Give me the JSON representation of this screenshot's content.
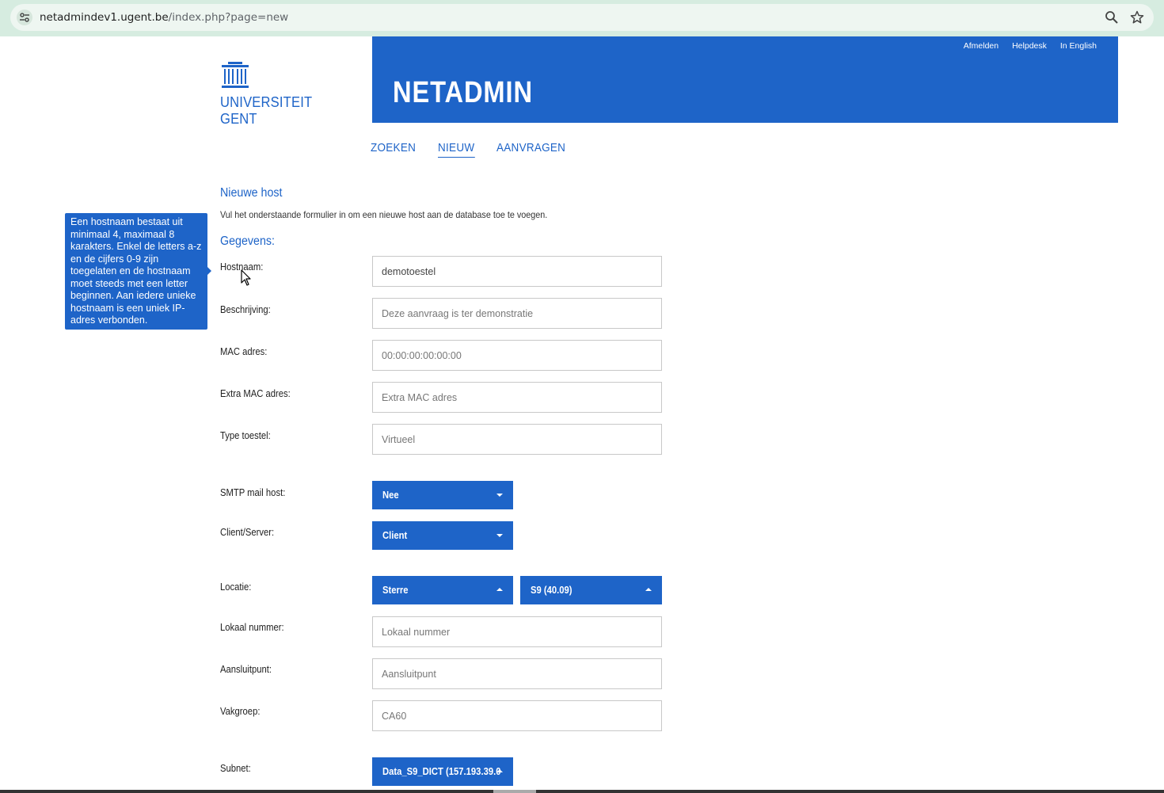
{
  "browser": {
    "url_host": "netadmindev1.ugent.be",
    "url_path": "/index.php?page=new"
  },
  "header": {
    "logo_line1": "UNIVERSITEIT",
    "logo_line2": "GENT",
    "title": "NETADMIN",
    "links": {
      "logout": "Afmelden",
      "helpdesk": "Helpdesk",
      "english": "In English"
    }
  },
  "nav": {
    "search": "ZOEKEN",
    "new": "NIEUW",
    "requests": "AANVRAGEN"
  },
  "page": {
    "title": "Nieuwe host",
    "intro": "Vul het onderstaande formulier in om een nieuwe host aan de database toe te voegen.",
    "section": "Gegevens:"
  },
  "tooltip": {
    "text": "Een hostnaam bestaat uit minimaal 4, maximaal 8 karakters. Enkel de letters a-z en de cijfers 0-9 zijn toegelaten en de hostnaam moet steeds met een letter beginnen. Aan iedere unieke hostnaam is een uniek IP-adres verbonden."
  },
  "form": {
    "hostname": {
      "label": "Hostnaam:",
      "value": "demotoestel",
      "placeholder": ""
    },
    "description": {
      "label": "Beschrijving:",
      "value": "",
      "placeholder": "Deze aanvraag is ter demonstratie"
    },
    "mac": {
      "label": "MAC adres:",
      "value": "",
      "placeholder": "00:00:00:00:00:00"
    },
    "extra_mac": {
      "label": "Extra MAC adres:",
      "value": "",
      "placeholder": "Extra MAC adres"
    },
    "device_type": {
      "label": "Type toestel:",
      "value": "",
      "placeholder": "Virtueel"
    },
    "smtp": {
      "label": "SMTP mail host:",
      "selected": "Nee"
    },
    "client_server": {
      "label": "Client/Server:",
      "selected": "Client"
    },
    "location": {
      "label": "Locatie:",
      "site": "Sterre",
      "building": "S9 (40.09)"
    },
    "room": {
      "label": "Lokaal nummer:",
      "value": "",
      "placeholder": "Lokaal nummer"
    },
    "connection_point": {
      "label": "Aansluitpunt:",
      "value": "",
      "placeholder": "Aansluitpunt"
    },
    "department": {
      "label": "Vakgroep:",
      "value": "",
      "placeholder": "CA60"
    },
    "subnet": {
      "label": "Subnet:",
      "selected": "Data_S9_DICT (157.193.39.0"
    }
  },
  "colors": {
    "brand_blue": "#1e64c8",
    "browser_bar": "#d6ece0"
  }
}
